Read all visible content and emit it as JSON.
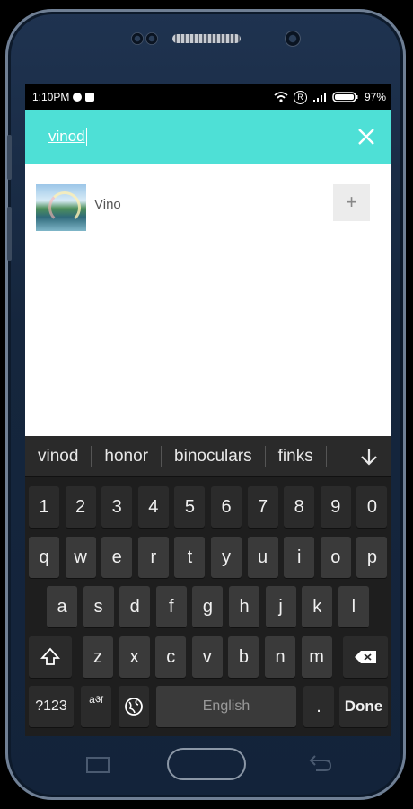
{
  "statusbar": {
    "time": "1:10PM",
    "battery": "97%",
    "registered": "R"
  },
  "search": {
    "query": "vinod"
  },
  "results": [
    {
      "name": "Vino"
    }
  ],
  "add_label": "+",
  "keyboard": {
    "suggestions": [
      "vinod",
      "honor",
      "binoculars",
      "finks"
    ],
    "row_numbers": [
      "1",
      "2",
      "3",
      "4",
      "5",
      "6",
      "7",
      "8",
      "9",
      "0"
    ],
    "row1": [
      "q",
      "w",
      "e",
      "r",
      "t",
      "y",
      "u",
      "i",
      "o",
      "p"
    ],
    "row2": [
      "a",
      "s",
      "d",
      "f",
      "g",
      "h",
      "j",
      "k",
      "l"
    ],
    "row3": [
      "z",
      "x",
      "c",
      "v",
      "b",
      "n",
      "m"
    ],
    "sym_label": "?123",
    "lang_switch": "aअ",
    "space_label": "English",
    "period_label": ".",
    "done_label": "Done"
  }
}
